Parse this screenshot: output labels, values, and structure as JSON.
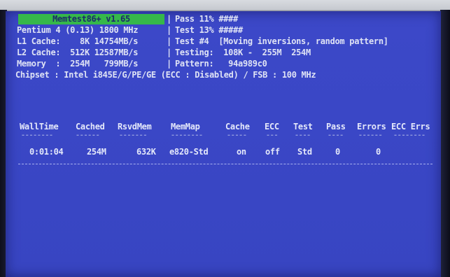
{
  "header": {
    "title": "Memtest86+ v1.65",
    "cpu": "Pentium 4 (0.13) 1800 MHz",
    "l1": "L1 Cache:    8K 14754MB/s",
    "l2": "L2 Cache:  512K 12587MB/s",
    "memory": "Memory  :  254M   799MB/s",
    "chipset": "Chipset : Intel i845E/G/PE/GE (ECC : Disabled) / FSB : 100 MHz"
  },
  "status": {
    "pass": "Pass 11% ####",
    "test_progress": "Test 13% #####",
    "test_name": "Test #4  [Moving inversions, random pattern]",
    "testing": "Testing:  108K -  255M  254M",
    "pattern": "Pattern:   94a989c0"
  },
  "separator": "|",
  "table": {
    "columns": [
      "WallTime",
      "Cached",
      "RsvdMem",
      "MemMap",
      "Cache",
      "ECC",
      "Test",
      "Pass",
      "Errors",
      "ECC Errs"
    ],
    "row": [
      "0:01:04",
      "254M",
      "632K",
      "e820-Std",
      "on",
      "off",
      "Std",
      "0",
      "0",
      ""
    ]
  }
}
